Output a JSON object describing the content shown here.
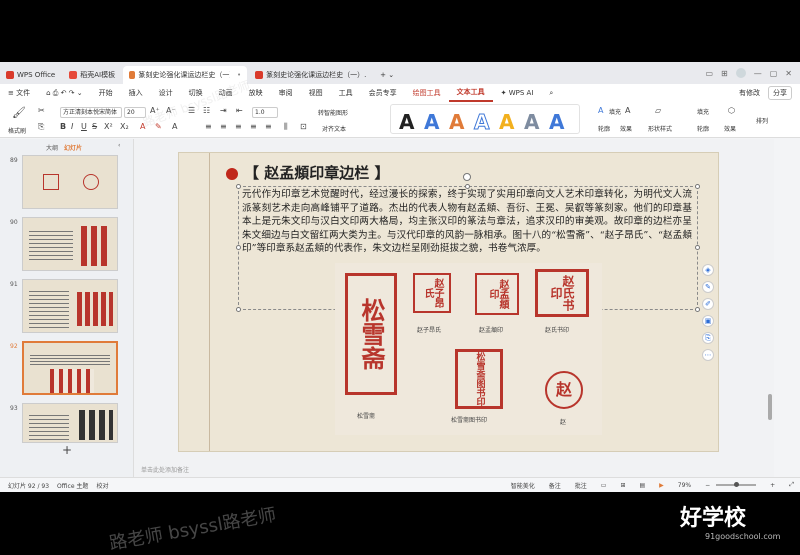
{
  "tabs": [
    {
      "label": "WPS Office",
      "color": "#d93a2b"
    },
    {
      "label": "稻壳AI模板",
      "color": "#e64a3b"
    },
    {
      "label": "篆刻史论强化课运边栏史（一）.pptx",
      "color": "#e07b39"
    },
    {
      "label": "篆刻史论强化课运边栏史（一）.pdf",
      "color": "#d93a2b"
    }
  ],
  "menu": {
    "file": "文件",
    "items": [
      "开始",
      "插入",
      "设计",
      "切换",
      "动画",
      "放映",
      "审阅",
      "视图",
      "工具",
      "会员专享"
    ],
    "draw_tools": "绘图工具",
    "text_tools": "文本工具",
    "wps_ai": "WPS AI",
    "share": "分享",
    "collab": "有修改"
  },
  "ribbon": {
    "format_painter": "格式刷",
    "font_name": "方正清刻本悦宋简体",
    "font_size": "20",
    "line_spacing": "1.0",
    "smart_shape": "转智能图形",
    "text_direction": "对齐文本",
    "fill": "填充",
    "outline": "轮廓",
    "effect": "效果",
    "shape_effect": "形状样式",
    "shape_fill": "填充",
    "shape_outline": "轮廓",
    "shape_effect2": "效果",
    "arrange": "排列"
  },
  "left_panel": {
    "tab_outline": "大纲",
    "tab_slides": "幻灯片",
    "slides": [
      {
        "num": "89"
      },
      {
        "num": "90"
      },
      {
        "num": "91"
      },
      {
        "num": "92",
        "active": true
      },
      {
        "num": "93"
      }
    ],
    "add": "+"
  },
  "slide": {
    "title": "【 赵孟頫印章边栏 】",
    "body": "元代作为印章艺术觉醒时代，经过漫长的探索，终于实现了实用印章向文人艺术印章转化，为明代文人流派篆刻艺术走向高峰铺平了道路。杰出的代表人物有赵孟頫、吾衍、王冕、吴叡等篆刻家。他们的印章基本上是元朱文印与汉白文印两大格局，均主张汉印的篆法与章法，追求汉印的审美观。故印章的边栏亦呈朱文细边与白文留红两大类为主。与汉代印章的风韵一脉相承。图十八的“松雪斋”、“赵子昂氏”、“赵孟頫印”等印章系赵孟頫的代表作，朱文边栏呈刚劲挺拔之貌，书卷气浓厚。",
    "seals": [
      {
        "text": "松雪斋",
        "caption": "松雪斋"
      },
      {
        "text": "赵子昂氏",
        "caption": "赵子昂氏"
      },
      {
        "text": "赵孟頫印",
        "caption": "赵孟頫印"
      },
      {
        "text": "赵氏书印",
        "caption": "赵氏书印"
      },
      {
        "text": "松雪斋图书印",
        "caption": "松雪斋图书印"
      },
      {
        "text": "赵",
        "caption": "赵"
      }
    ]
  },
  "notes_placeholder": "单击此处添加备注",
  "status": {
    "slide_count": "幻灯片 92 / 93",
    "theme": "Office 主题",
    "proof": "校对",
    "smart_beautify": "智能美化",
    "notes": "备注",
    "comments": "批注",
    "zoom": "79%"
  },
  "watermarks": [
    "路老师 bsyssl路老师",
    "路老师 bsyssl路老师",
    "好学校"
  ],
  "logo": {
    "main": "好学校",
    "sub": "91goodschool.com"
  },
  "colors": {
    "accent": "#c0392b",
    "seal_red": "#b8352c",
    "slide_bg": "#ede6d6"
  }
}
